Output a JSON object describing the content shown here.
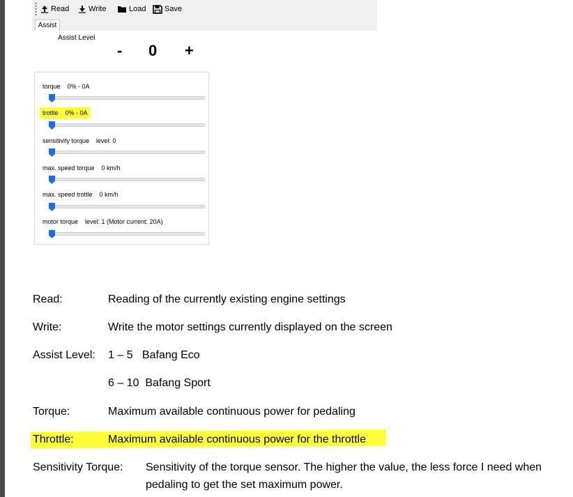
{
  "toolbar": {
    "read_label": "Read",
    "write_label": "Write",
    "load_label": "Load",
    "save_label": "Save"
  },
  "tab_label": "Assist",
  "assist_level": {
    "label": "Assist Level",
    "minus": "-",
    "value": "0",
    "plus": "+"
  },
  "sliders": [
    {
      "name": "torque",
      "value": "0% - 0A",
      "level": 0
    },
    {
      "name": "trottle",
      "value": "0% - 0A",
      "level": 0
    },
    {
      "name": "sensitivity torque",
      "value": "level: 0",
      "level": 0
    },
    {
      "name": "max. speed torque",
      "value": "0 km/h",
      "level": 0
    },
    {
      "name": "max. speed trottle",
      "value": "0 km/h",
      "level": 0
    },
    {
      "name": "motor torque",
      "value": "level: 1 (Motor current: 20A)",
      "level": 0
    }
  ],
  "doc": {
    "read_term": "Read:",
    "read_desc": "Reading of the currently existing engine settings",
    "write_term": "Write:",
    "write_desc": "Write the motor settings currently displayed on the screen",
    "assist_term": "Assist Level:",
    "assist_desc1": "1 – 5   Bafang Eco",
    "assist_desc2": "6 – 10  Bafang Sport",
    "torque_term": "Torque:",
    "torque_desc": "Maximum available continuous power for pedaling",
    "throttle_term": "Throttle:",
    "throttle_desc": "Maximum available continuous power for the throttle",
    "sens_term": "Sensitivity Torque:",
    "sens_desc1": "Sensitivity of the torque sensor. The higher the value, the less force I need when",
    "sens_desc2": "pedaling to get the set maximum power."
  },
  "colors": {
    "highlight": "#ffff3a",
    "slider_thumb": "#1f6fe0"
  }
}
